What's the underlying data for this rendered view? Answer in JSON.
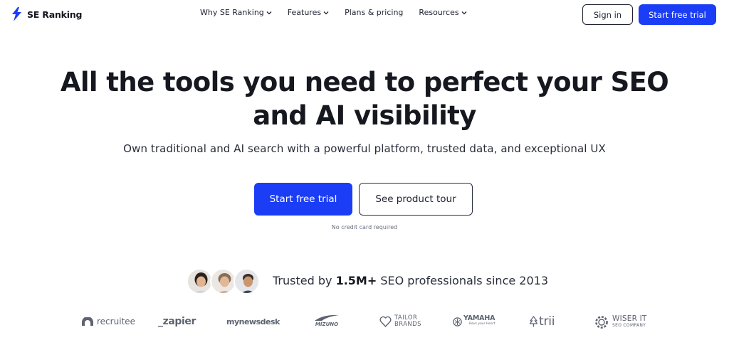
{
  "brand": {
    "name": "SE Ranking"
  },
  "nav": {
    "items": [
      {
        "label": "Why SE Ranking",
        "dropdown": true
      },
      {
        "label": "Features",
        "dropdown": true
      },
      {
        "label": "Plans & pricing",
        "dropdown": false
      },
      {
        "label": "Resources",
        "dropdown": true
      }
    ]
  },
  "header": {
    "signin_label": "Sign in",
    "trial_label": "Start free trial"
  },
  "hero": {
    "headline_line1": "All the tools you need to perfect your SEO",
    "headline_line2": "and AI visibility",
    "subheadline": "Own traditional and AI search with a powerful platform, trusted data, and exceptional UX",
    "primary_cta": "Start free trial",
    "secondary_cta": "See product tour",
    "note": "No credit card required"
  },
  "trust": {
    "prefix": "Trusted by",
    "count": "1.5M+",
    "suffix": "SEO professionals since 2013"
  },
  "logos": [
    {
      "name": "recruitee"
    },
    {
      "name": "_zapier"
    },
    {
      "name": "mynewsdesk"
    },
    {
      "name": "MIZUNO"
    },
    {
      "name": "TAILOR",
      "sub": "BRANDS"
    },
    {
      "name": "YAMAHA",
      "sub": "Revs your Heart"
    },
    {
      "name": "trii"
    },
    {
      "name": "WISER IT",
      "sub": "SEO COMPANY"
    }
  ],
  "colors": {
    "accent": "#1b3df5",
    "text": "#16181f",
    "muted": "#5d6370"
  }
}
